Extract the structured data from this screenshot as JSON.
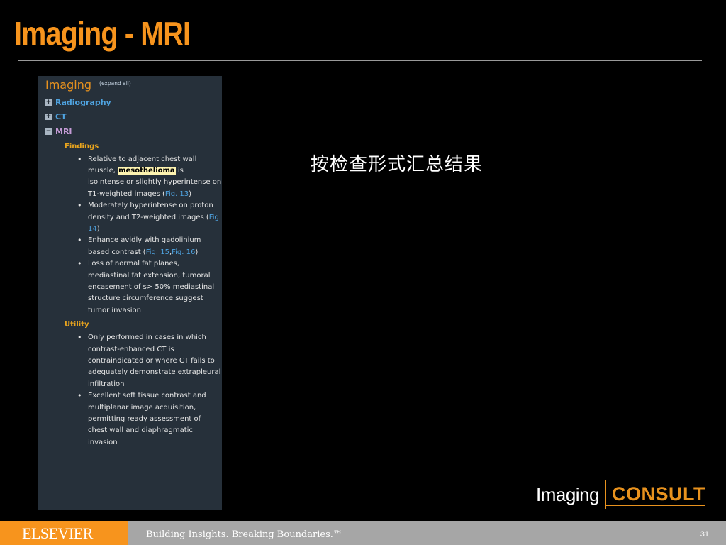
{
  "slide": {
    "title": "Imaging - MRI",
    "body_text": "按检查形式汇总结果",
    "page_number": "31"
  },
  "panel": {
    "title": "Imaging",
    "expand_all": "(expand all)",
    "tree": [
      {
        "toggle": "+",
        "label": "Radiography"
      },
      {
        "toggle": "+",
        "label": "CT"
      },
      {
        "toggle": "−",
        "label": "MRI"
      }
    ],
    "findings": {
      "heading": "Findings",
      "items": [
        {
          "pre": "Relative to adjacent chest wall muscle, ",
          "highlight": "mesothelioma",
          "post": " is isointense or slightly hyperintense on T1-weighted images (",
          "links": [
            "Fig. 13"
          ],
          "end": ")"
        },
        {
          "pre": "Moderately hyperintense on proton density and T2-weighted images (",
          "links": [
            "Fig. 14"
          ],
          "end": ")"
        },
        {
          "pre": "Enhance avidly with gadolinium based contrast (",
          "links": [
            "Fig. 15",
            "Fig. 16"
          ],
          "end": ")"
        },
        {
          "pre": "Loss of normal fat planes, mediastinal fat extension, tumoral encasement of s> 50% mediastinal structure circumference suggest tumor invasion"
        }
      ]
    },
    "utility": {
      "heading": "Utility",
      "items": [
        "Only performed in cases in which contrast-enhanced CT is contraindicated or where CT fails to adequately demonstrate extrapleural infiltration",
        "Excellent soft tissue contrast and multiplanar image acquisition, permitting ready assessment of chest wall and diaphragmatic invasion"
      ]
    }
  },
  "logo": {
    "part1": "Imaging",
    "part2": "CONSULT"
  },
  "footer": {
    "brand": "ELSEVIER",
    "tagline": "Building Insights. Breaking Boundaries.™"
  },
  "colors": {
    "accent_orange": "#f7941d",
    "panel_bg": "#26303a",
    "link_blue": "#4fa3e0",
    "mri_purple": "#c49bd6",
    "footer_gray": "#a6a6a6"
  }
}
